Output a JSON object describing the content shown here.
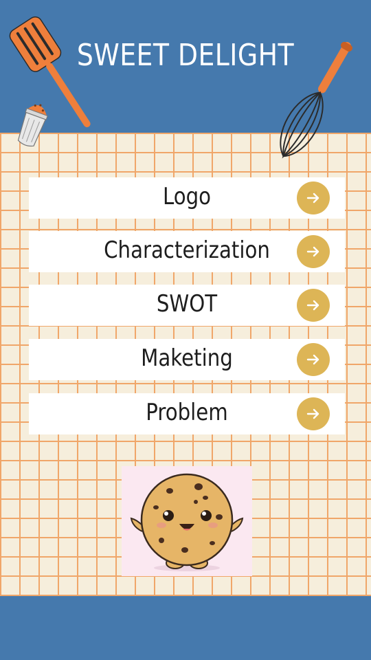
{
  "header": {
    "title": "SWEET DELIGHT"
  },
  "menu": {
    "items": [
      {
        "label": "Logo",
        "icon": "arrow-right-icon"
      },
      {
        "label": "Characterization",
        "icon": "arrow-right-icon"
      },
      {
        "label": "SWOT",
        "icon": "arrow-right-icon"
      },
      {
        "label": "Maketing",
        "icon": "arrow-right-icon"
      },
      {
        "label": "Problem",
        "icon": "arrow-right-icon"
      }
    ]
  },
  "colors": {
    "header_blue": "#4579ad",
    "grid_line": "#f0a669",
    "background": "#f6eedc",
    "button_gold": "#ddb556",
    "utensil_orange": "#ee7f3c"
  }
}
